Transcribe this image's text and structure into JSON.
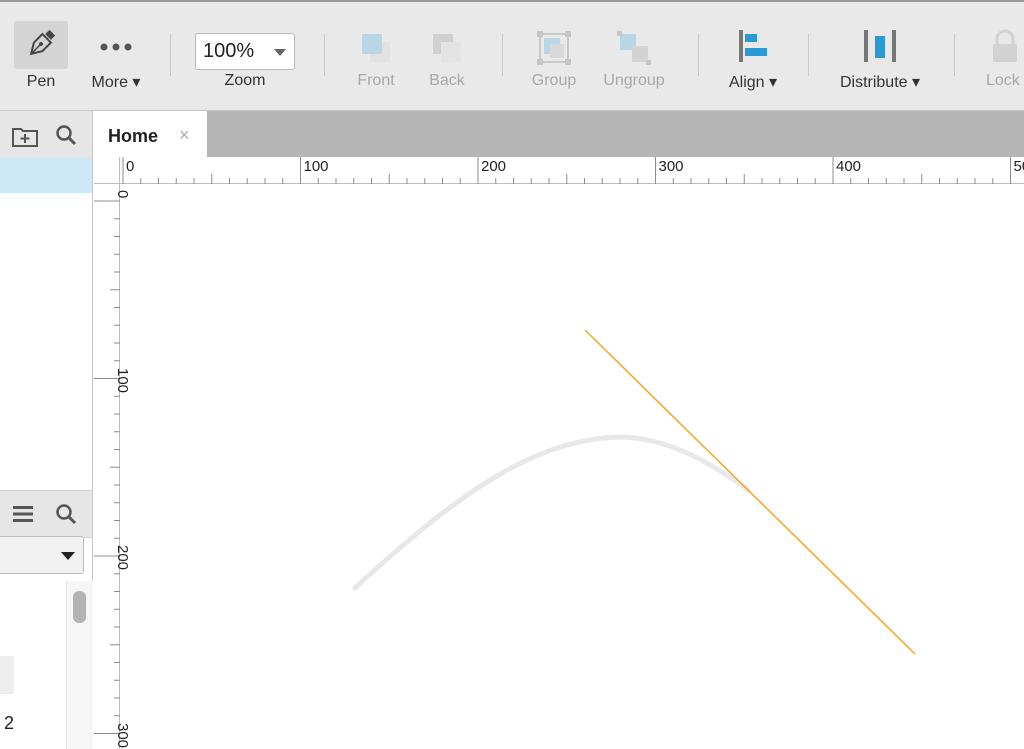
{
  "toolbar": {
    "pen": "Pen",
    "more": "More ▾",
    "zoom_value": "100%",
    "zoom_label": "Zoom",
    "front": "Front",
    "back": "Back",
    "group": "Group",
    "ungroup": "Ungroup",
    "align": "Align ▾",
    "distribute": "Distribute ▾",
    "lock": "Lock"
  },
  "tab": {
    "label": "Home",
    "close": "×"
  },
  "rulers": {
    "horizontal": [
      "0",
      "100",
      "200",
      "300",
      "400",
      "50"
    ],
    "vertical": [
      "0",
      "100",
      "200",
      "300"
    ]
  },
  "left_panel": {
    "item_text": "2"
  },
  "colors": {
    "accent": "#2a9ad6",
    "tangent_line": "#f4a623",
    "curve": "#e8e8e8",
    "selection": "#cde9f7"
  }
}
